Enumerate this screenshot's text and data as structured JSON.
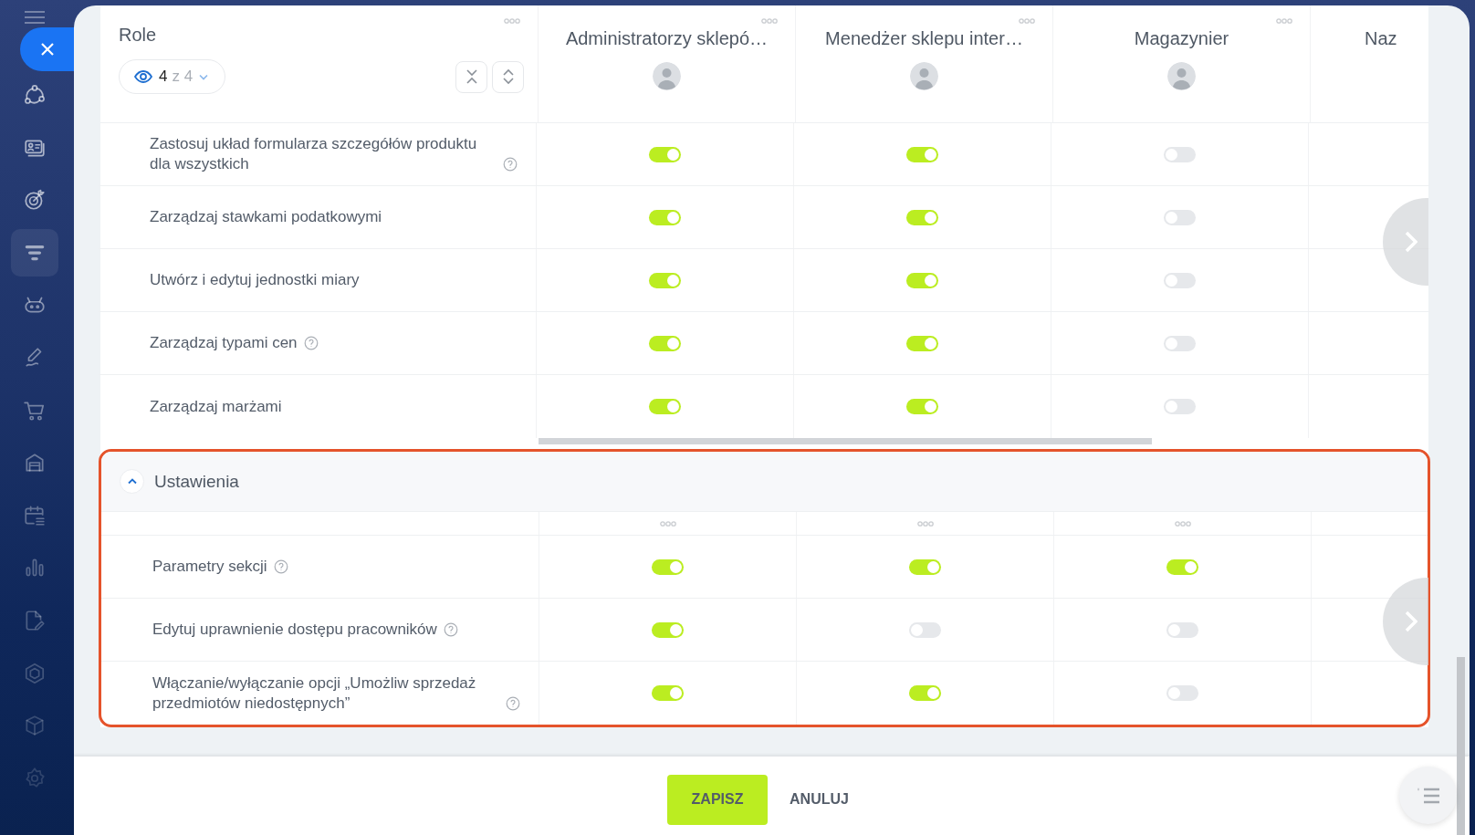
{
  "sidebar": {
    "items": [
      {
        "selected": false
      },
      {
        "selected": false
      },
      {
        "selected": false
      },
      {
        "selected": true
      },
      {
        "selected": false
      },
      {
        "selected": false
      },
      {
        "selected": false
      },
      {
        "selected": false
      },
      {
        "selected": false
      },
      {
        "selected": false
      },
      {
        "selected": false
      },
      {
        "selected": false
      },
      {
        "selected": false
      },
      {
        "selected": false
      }
    ]
  },
  "role_header": {
    "title": "Role",
    "filter": {
      "count": "4",
      "total": "z 4"
    }
  },
  "columns": [
    {
      "name": "Administratorzy sklepó…",
      "kind": "full"
    },
    {
      "name": "Menedżer sklepu inter…",
      "kind": "full"
    },
    {
      "name": "Magazynier",
      "kind": "full"
    },
    {
      "name": "Naz",
      "kind": "cut"
    }
  ],
  "sections": [
    {
      "rows": [
        {
          "label": "Zastosuj układ formularza szczegółów produktu dla wszystkich",
          "help": true,
          "access": [
            true,
            true,
            false
          ]
        },
        {
          "label": "Zarządzaj stawkami podatkowymi",
          "help": false,
          "access": [
            true,
            true,
            false
          ]
        },
        {
          "label": "Utwórz i edytuj jednostki miary",
          "help": false,
          "access": [
            true,
            true,
            false
          ]
        },
        {
          "label": "Zarządzaj typami cen",
          "help": true,
          "access": [
            true,
            true,
            false
          ]
        },
        {
          "label": "Zarządzaj marżami",
          "help": false,
          "access": [
            true,
            true,
            false
          ]
        }
      ]
    },
    {
      "title": "Ustawienia",
      "expanded": true,
      "highlighted": true,
      "rows": [
        {
          "label": "Parametry sekcji",
          "help": true,
          "access": [
            true,
            true,
            true
          ]
        },
        {
          "label": "Edytuj uprawnienie dostępu pracowników",
          "help": true,
          "access": [
            true,
            false,
            false
          ]
        },
        {
          "label": "Włączanie/wyłączanie opcji „Umożliw sprzedaż przedmiotów niedostępnych”",
          "help": true,
          "access": [
            true,
            true,
            false
          ]
        }
      ]
    }
  ],
  "footer": {
    "buttons": [
      {
        "label": "ZAPISZ",
        "kind": "primary"
      },
      {
        "label": "ANULUJ",
        "kind": "link"
      }
    ]
  }
}
